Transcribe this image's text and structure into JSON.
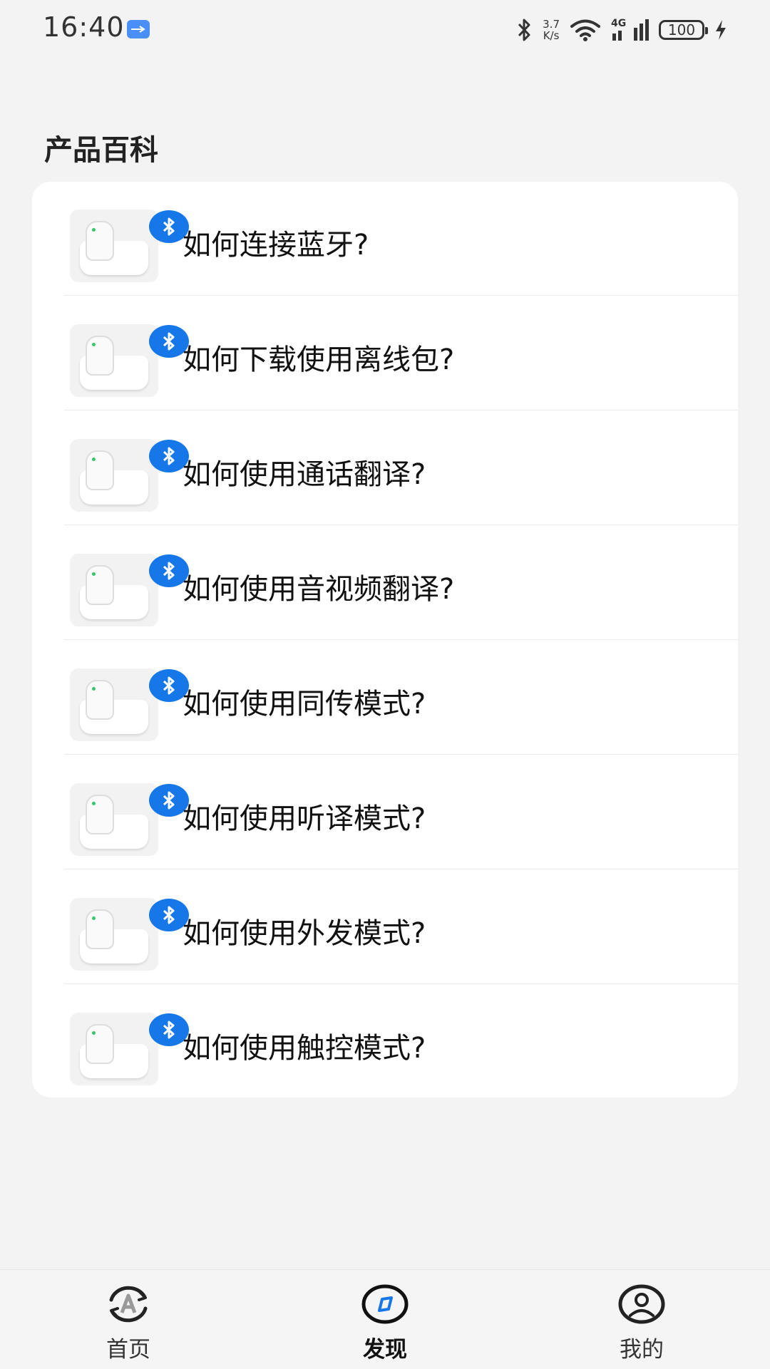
{
  "status_bar": {
    "time": "16:40",
    "net_speed_value": "3.7",
    "net_speed_unit": "K/s",
    "network": "4G",
    "battery": "100"
  },
  "section": {
    "title": "产品百科"
  },
  "items": [
    {
      "label": "如何连接蓝牙?"
    },
    {
      "label": "如何下载使用离线包?"
    },
    {
      "label": "如何使用通话翻译?"
    },
    {
      "label": "如何使用音视频翻译?"
    },
    {
      "label": "如何使用同传模式?"
    },
    {
      "label": "如何使用听译模式?"
    },
    {
      "label": "如何使用外发模式?"
    },
    {
      "label": "如何使用触控模式?"
    }
  ],
  "bottom_nav": {
    "home": "首页",
    "discover": "发现",
    "mine": "我的",
    "active": "discover"
  },
  "colors": {
    "accent_blue": "#1677e9"
  }
}
